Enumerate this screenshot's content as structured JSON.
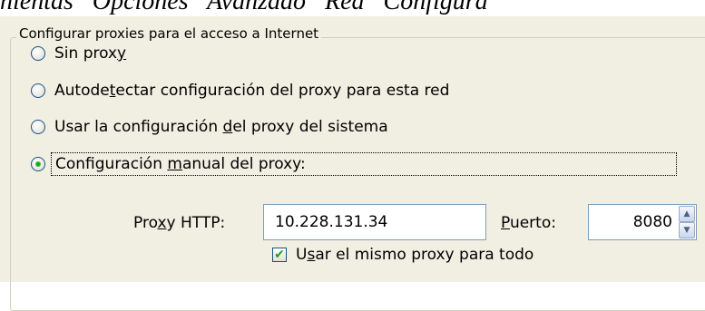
{
  "caption": "anientas   Opciones   Avanzado   Red   Configura",
  "group": {
    "title": "Configurar proxies para el acceso a Internet"
  },
  "options": [
    {
      "pre": "Sin prox",
      "key": "y",
      "post": "",
      "checked": false
    },
    {
      "pre": "Autode",
      "key": "t",
      "post": "ectar configuración del proxy para esta red",
      "checked": false
    },
    {
      "pre": "Usar la configuración ",
      "key": "d",
      "post": "el proxy del sistema",
      "checked": false
    },
    {
      "pre": "Configuración ",
      "key": "m",
      "post": "anual del proxy:",
      "checked": true
    }
  ],
  "http": {
    "label_pre": "Pro",
    "label_key": "x",
    "label_post": "y HTTP:",
    "value": "10.228.131.34"
  },
  "port": {
    "label_pre": "",
    "label_key": "P",
    "label_post": "uerto:",
    "value": "8080"
  },
  "same_proxy": {
    "label_pre": "U",
    "label_key": "s",
    "label_post": "ar el mismo proxy para todo",
    "checked": true
  },
  "colors": {
    "panel_bg": "#f1efe2",
    "radio_check": "#21a121",
    "field_border": "#7f9db9"
  }
}
